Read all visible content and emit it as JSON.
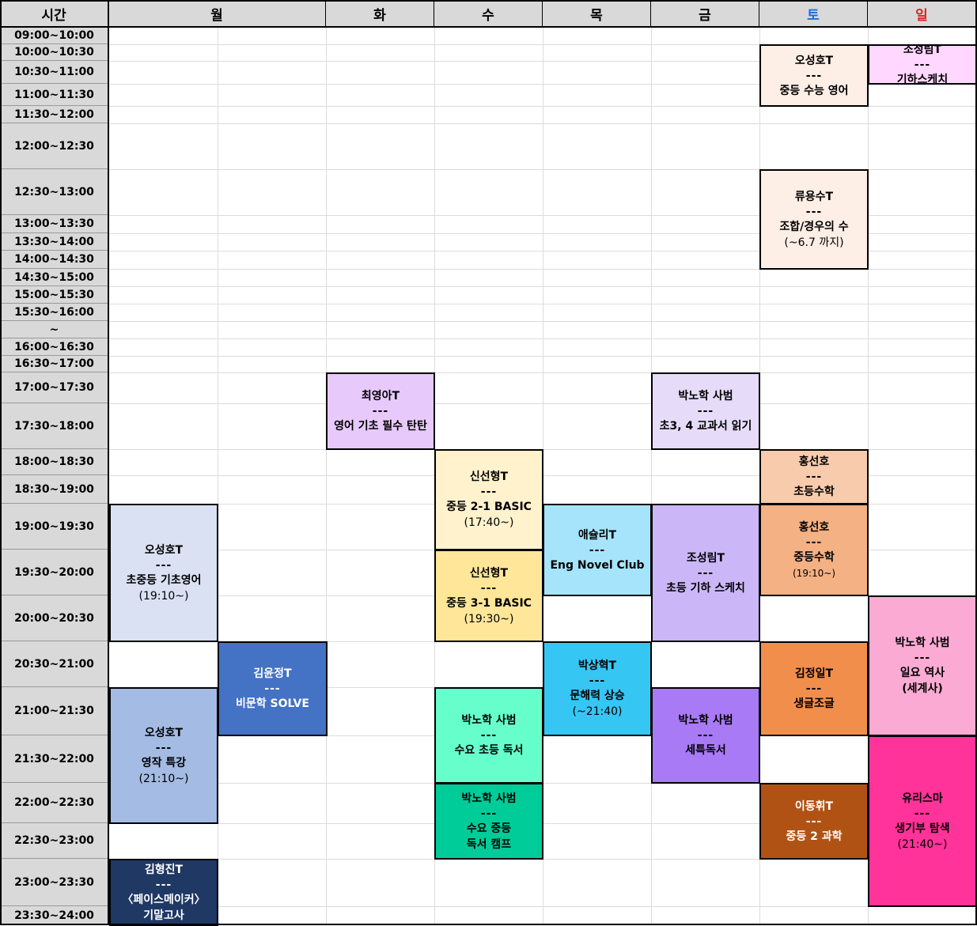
{
  "header": {
    "time_label": "시간",
    "days": [
      {
        "label": "월",
        "color": "#000000"
      },
      {
        "label": "화",
        "color": "#000000"
      },
      {
        "label": "수",
        "color": "#000000"
      },
      {
        "label": "목",
        "color": "#000000"
      },
      {
        "label": "금",
        "color": "#000000"
      },
      {
        "label": "토",
        "color": "#1f6fd1"
      },
      {
        "label": "일",
        "color": "#e02020"
      }
    ]
  },
  "time_slots": [
    "09:00~10:00",
    "10:00~10:30",
    "10:30~11:00",
    "11:00~11:30",
    "11:30~12:00",
    "12:00~12:30",
    "12:30~13:00",
    "13:00~13:30",
    "13:30~14:00",
    "14:00~14:30",
    "14:30~15:00",
    "15:00~15:30",
    "15:30~16:00",
    "~",
    "16:00~16:30",
    "16:30~17:00",
    "17:00~17:30",
    "17:30~18:00",
    "18:00~18:30",
    "18:30~19:00",
    "19:00~19:30",
    "19:30~20:00",
    "20:00~20:30",
    "20:30~21:00",
    "21:00~21:30",
    "21:30~22:00",
    "22:00~22:30",
    "22:30~23:00",
    "23:00~23:30",
    "23:30~24:00"
  ],
  "separator": "---",
  "events": [
    {
      "day": "토",
      "start": "10:00",
      "end": "11:30",
      "teacher": "오성호T",
      "title": "중등 수능 영어",
      "note": "",
      "color": "#fdeee6"
    },
    {
      "day": "일",
      "start": "10:00",
      "end": "11:00",
      "teacher": "조성림T",
      "title": "기하스케치",
      "note": "",
      "color": "#ffd7ff"
    },
    {
      "day": "토",
      "start": "12:30",
      "end": "14:30",
      "teacher": "류용수T",
      "title": "조합/경우의 수",
      "note": "(~6.7 까지)",
      "color": "#fdeee6"
    },
    {
      "day": "화",
      "start": "17:00",
      "end": "18:00",
      "teacher": "최영아T",
      "title": "영어 기초 필수 탄탄",
      "note": "",
      "color": "#e8c9fb"
    },
    {
      "day": "금",
      "start": "17:00",
      "end": "18:00",
      "teacher": "박노학 사범",
      "title": "초3, 4 교과서 읽기",
      "note": "",
      "color": "#e6dcf9"
    },
    {
      "day": "수",
      "start": "18:00",
      "end": "19:30",
      "teacher": "신선형T",
      "title": "중등 2-1 BASIC",
      "note": "(17:40~)",
      "color": "#fff2cc"
    },
    {
      "day": "토",
      "start": "18:00",
      "end": "19:00",
      "teacher": "홍선호",
      "title": "초등수학",
      "note": "",
      "color": "#f8cbad"
    },
    {
      "day": "월",
      "start": "19:00",
      "end": "20:30",
      "teacher": "오성호T",
      "title": "초중등 기초영어",
      "note": "(19:10~)",
      "color": "#dae1f3"
    },
    {
      "day": "목",
      "start": "19:00",
      "end": "20:00",
      "teacher": "애슐리T",
      "title": "Eng Novel Club",
      "note": "",
      "color": "#a6e4fb"
    },
    {
      "day": "금",
      "start": "19:00",
      "end": "20:30",
      "teacher": "조성림T",
      "title": "초등 기하 스케치",
      "note": "",
      "color": "#cbb7f8"
    },
    {
      "day": "토",
      "start": "19:00",
      "end": "20:00",
      "teacher": "홍선호",
      "title": "중등수학",
      "note": "(19:10~)",
      "color": "#f4b183"
    },
    {
      "day": "수",
      "start": "19:30",
      "end": "20:30",
      "teacher": "신선형T",
      "title": "중등 3-1 BASIC",
      "note": "(19:30~)",
      "color": "#ffe699"
    },
    {
      "day": "일",
      "start": "20:00",
      "end": "21:30",
      "teacher": "박노학 사범",
      "title": "일요 역사",
      "note": "(세계사)",
      "color": "#fbabd3"
    },
    {
      "day": "화",
      "start": "20:30",
      "end": "21:30",
      "teacher": "김윤정T",
      "title": "비문학 SOLVE",
      "note": "",
      "color": "#4472c4"
    },
    {
      "day": "목",
      "start": "20:30",
      "end": "21:30",
      "teacher": "박상혁T",
      "title": "문해력 상승",
      "note": "(~21:40)",
      "color": "#35c6f4"
    },
    {
      "day": "토",
      "start": "20:30",
      "end": "21:30",
      "teacher": "김정일T",
      "title": "생글조글",
      "note": "",
      "color": "#f28e4c"
    },
    {
      "day": "월",
      "start": "21:00",
      "end": "22:30",
      "teacher": "오성호T",
      "title": "영작 특강",
      "note": "(21:10~)",
      "color": "#a4bbe3"
    },
    {
      "day": "수",
      "start": "21:00",
      "end": "22:00",
      "teacher": "박노학 사범",
      "title": "수요 초등 독서",
      "note": "",
      "color": "#66ffcc"
    },
    {
      "day": "금",
      "start": "21:00",
      "end": "22:00",
      "teacher": "박노학 사범",
      "title": "세특독서",
      "note": "",
      "color": "#a87af5"
    },
    {
      "day": "일",
      "start": "21:30",
      "end": "23:30",
      "teacher": "유리스마",
      "title": "생기부 탐색",
      "note": "(21:40~)",
      "color": "#ff3399"
    },
    {
      "day": "수",
      "start": "22:00",
      "end": "23:00",
      "teacher": "박노학 사범",
      "title": "수요 중등",
      "note": "독서 캠프",
      "color": "#00cc99"
    },
    {
      "day": "토",
      "start": "22:00",
      "end": "23:00",
      "teacher": "이동휘T",
      "title": "중등 2 과학",
      "note": "",
      "color": "#b15215"
    },
    {
      "day": "월",
      "start": "23:00",
      "end": "24:00",
      "teacher": "김형진T",
      "title": "〈페이스메이커〉",
      "note": "기말고사",
      "color": "#1f3864"
    }
  ]
}
